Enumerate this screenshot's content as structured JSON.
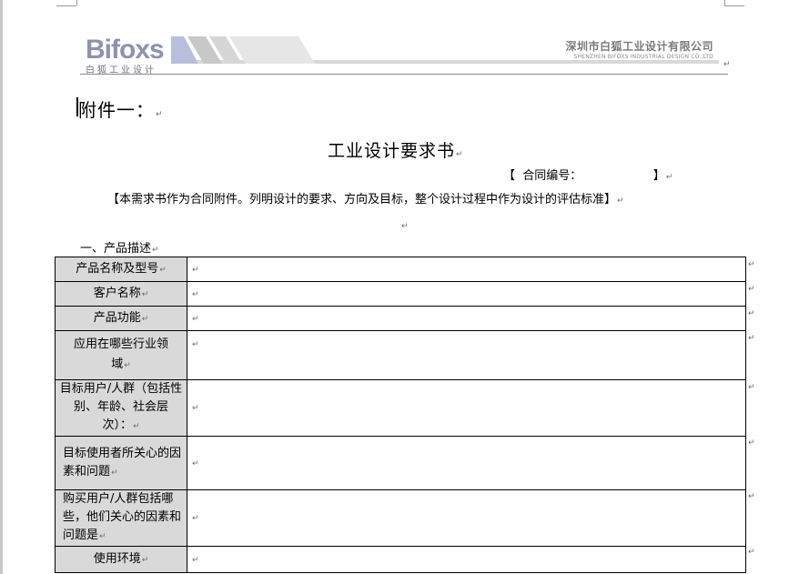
{
  "header": {
    "logo_text": "Bifoxs",
    "logo_sub": "白狐工业设计",
    "company_cn": "深圳市白狐工业设计有限公司",
    "company_en": "SHENZHEN BIFOXS INDUSTRIAL DESIGN CO.,LTD"
  },
  "attachment_label": "附件一：",
  "title": "工业设计要求书",
  "contract_no": "【  合同编号：                   】",
  "note": "【本需求书作为合同附件。列明设计的要求、方向及目标，整个设计过程中作为设计的评估标准】",
  "section_title": "一、产品描述",
  "paragraph_mark": "↵",
  "rows": [
    {
      "label": "产品名称及型号",
      "value": ""
    },
    {
      "label": "客户名称",
      "value": ""
    },
    {
      "label": "产品功能",
      "value": ""
    },
    {
      "label": "应用在哪些行业领域",
      "value": ""
    },
    {
      "label": "目标用户/人群（包括性别、年龄、社会层次）：",
      "value": ""
    },
    {
      "label": "目标使用者所关心的因素和问题",
      "value": ""
    },
    {
      "label": "购买用户/人群包括哪些，他们关心的因素和问题是",
      "value": ""
    },
    {
      "label": "使用环境",
      "value": ""
    }
  ],
  "colors": {
    "label_bg": "#d9d9d9",
    "logo": "#8c93b0"
  }
}
